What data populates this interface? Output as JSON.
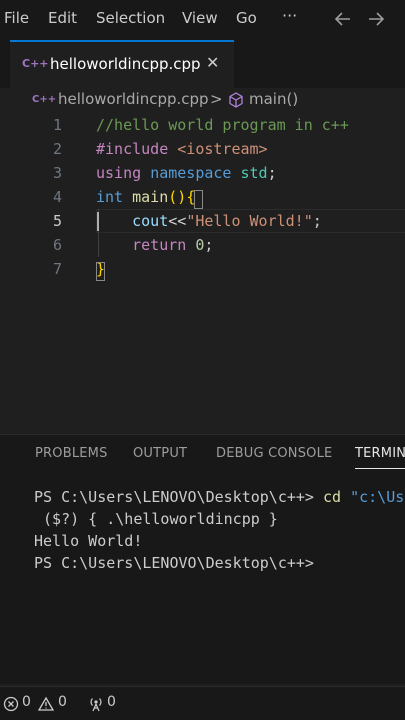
{
  "menu": {
    "items": [
      "File",
      "Edit",
      "Selection",
      "View",
      "Go"
    ],
    "more": "···",
    "back_icon": "arrow-left-icon",
    "forward_icon": "arrow-right-icon"
  },
  "tabs": [
    {
      "icon": "C++",
      "label": "helloworldincpp.cpp",
      "close": "✕"
    }
  ],
  "breadcrumb": {
    "file_icon": "C++",
    "file": "helloworldincpp.cpp",
    "separator": ">",
    "symbol": "main()"
  },
  "editor": {
    "line_numbers": [
      "1",
      "2",
      "3",
      "4",
      "5",
      "6",
      "7"
    ],
    "active_line": "5",
    "lines": [
      [
        {
          "t": "//hello world program in c++",
          "c": "#6a9955"
        }
      ],
      [
        {
          "t": "#include ",
          "c": "#c586c0"
        },
        {
          "t": "<iostream>",
          "c": "#ce9178"
        }
      ],
      [
        {
          "t": "using ",
          "c": "#c586c0"
        },
        {
          "t": "namespace ",
          "c": "#569cd6"
        },
        {
          "t": "std",
          "c": "#4ec9b0"
        },
        {
          "t": ";",
          "c": "#cccccc"
        }
      ],
      [
        {
          "t": "int ",
          "c": "#569cd6"
        },
        {
          "t": "main",
          "c": "#dcdcaa"
        },
        {
          "t": "()",
          "c": "#ffd700"
        },
        {
          "t": "{",
          "c": "#ffd700"
        }
      ],
      [
        {
          "t": "    ",
          "c": "#cccccc"
        },
        {
          "t": "cout",
          "c": "#9cdcfe"
        },
        {
          "t": "<<",
          "c": "#d4d4d4"
        },
        {
          "t": "\"Hello World!\"",
          "c": "#ce9178"
        },
        {
          "t": ";",
          "c": "#cccccc"
        }
      ],
      [
        {
          "t": "    ",
          "c": "#cccccc"
        },
        {
          "t": "return ",
          "c": "#c586c0"
        },
        {
          "t": "0",
          "c": "#b5cea8"
        },
        {
          "t": ";",
          "c": "#cccccc"
        }
      ],
      [
        {
          "t": "}",
          "c": "#ffd700"
        }
      ]
    ]
  },
  "panel": {
    "tabs": [
      "PROBLEMS",
      "OUTPUT",
      "DEBUG CONSOLE",
      "TERMINA"
    ],
    "active_tab": "TERMINA",
    "terminal_lines": [
      [
        {
          "t": "PS C:\\Users\\LENOVO\\Desktop\\c++> ",
          "c": "#cccccc"
        },
        {
          "t": "cd ",
          "c": "#dcdcaa"
        },
        {
          "t": "\"c:\\Us",
          "c": "#569cd6"
        }
      ],
      [
        {
          "t": " ($?) { .\\helloworldincpp }",
          "c": "#cccccc"
        }
      ],
      [
        {
          "t": "Hello World!",
          "c": "#cccccc"
        }
      ],
      [
        {
          "t": "PS C:\\Users\\LENOVO\\Desktop\\c++>",
          "c": "#cccccc"
        }
      ]
    ]
  },
  "status": {
    "errors_icon": "error-circle-icon",
    "errors": "0",
    "warnings_icon": "warning-triangle-icon",
    "warnings": "0",
    "ports_icon": "broadcast-icon",
    "ports": "0"
  },
  "colors": {
    "accent": "#0078d4",
    "cpp_icon": "#a074c4",
    "editor_bg": "#1f1f1f",
    "chrome_bg": "#181818"
  }
}
